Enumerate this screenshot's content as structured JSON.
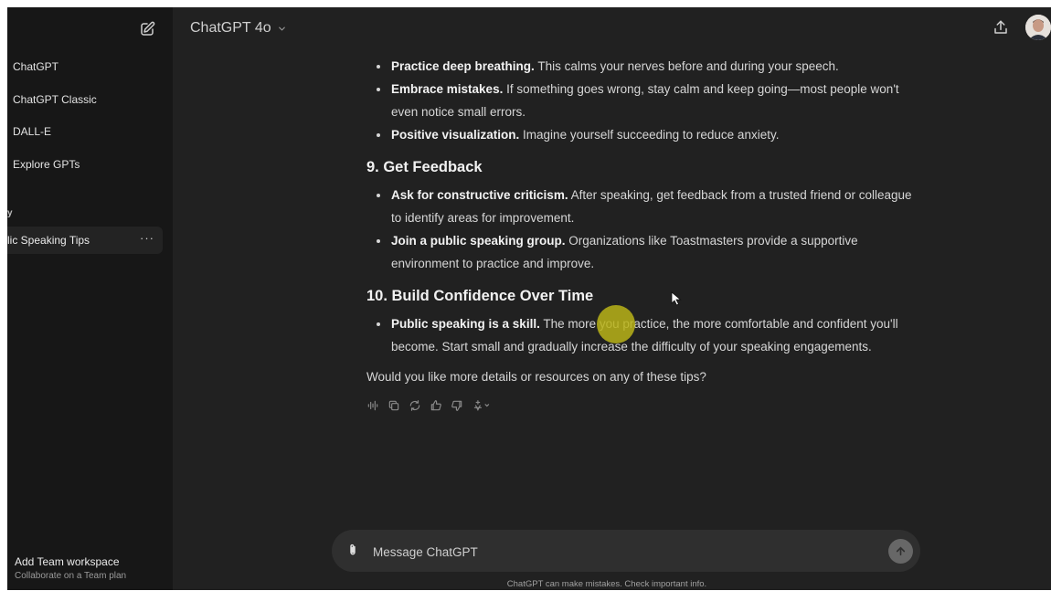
{
  "sidebar": {
    "items": [
      {
        "label": "ChatGPT"
      },
      {
        "label": "ChatGPT Classic"
      },
      {
        "label": "DALL-E"
      },
      {
        "label": "Explore GPTs"
      }
    ],
    "section_label": "y",
    "chat": {
      "label": "lic Speaking Tips",
      "more": "···"
    },
    "team": {
      "title": "Add Team workspace",
      "subtitle": "Collaborate on a Team plan"
    }
  },
  "header": {
    "model": "ChatGPT 4o"
  },
  "content": {
    "list1": [
      {
        "bold": "Practice deep breathing.",
        "text": " This calms your nerves before and during your speech."
      },
      {
        "bold": "Embrace mistakes.",
        "text": " If something goes wrong, stay calm and keep going—most people won't even notice small errors."
      },
      {
        "bold": "Positive visualization.",
        "text": " Imagine yourself succeeding to reduce anxiety."
      }
    ],
    "heading9": "9. Get Feedback",
    "list9": [
      {
        "bold": "Ask for constructive criticism.",
        "text": " After speaking, get feedback from a trusted friend or colleague to identify areas for improvement."
      },
      {
        "bold": "Join a public speaking group.",
        "text": " Organizations like Toastmasters provide a supportive environment to practice and improve."
      }
    ],
    "heading10": "10. Build Confidence Over Time",
    "list10": [
      {
        "bold": "Public speaking is a skill.",
        "text": " The more you practice, the more comfortable and confident you'll become. Start small and gradually increase the difficulty of your speaking engagements."
      }
    ],
    "closing": "Would you like more details or resources on any of these tips?"
  },
  "composer": {
    "placeholder": "Message ChatGPT"
  },
  "disclaimer": "ChatGPT can make mistakes. Check important info.",
  "colors": {
    "background": "#212121",
    "sidebar": "#171717",
    "composer": "#2f2f2f",
    "highlight": "#b9b318"
  }
}
